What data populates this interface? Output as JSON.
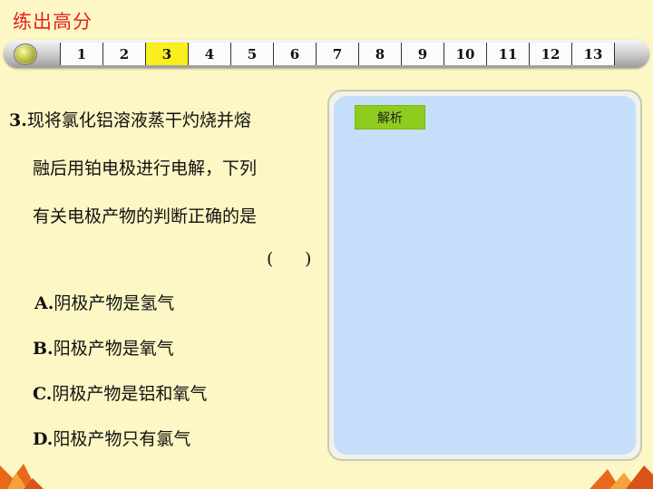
{
  "title": "练出高分",
  "nav": {
    "items": [
      "1",
      "2",
      "3",
      "4",
      "5",
      "6",
      "7",
      "8",
      "9",
      "10",
      "11",
      "12",
      "13"
    ],
    "active_index": 2,
    "active_color": "#f8ef1c"
  },
  "question": {
    "number": "3.",
    "lines": [
      "现将氯化铝溶液蒸干灼烧并熔",
      "融后用铂电极进行电解，下列",
      "有关电极产物的判断正确的是"
    ],
    "paren_open": "(",
    "paren_close": ")",
    "options": [
      {
        "letter": "A.",
        "text": "阴极产物是氢气"
      },
      {
        "letter": "B.",
        "text": "阳极产物是氧气"
      },
      {
        "letter": "C.",
        "text": "阴极产物是铝和氧气"
      },
      {
        "letter": "D.",
        "text": "阳极产物只有氯气"
      }
    ]
  },
  "analysis": {
    "button_label": "解析",
    "button_color": "#8fcc1e",
    "panel_color": "#c5defa"
  },
  "colors": {
    "background": "#fcf7c4",
    "title": "#e8201c",
    "corner_decoration": "#e8691c"
  }
}
